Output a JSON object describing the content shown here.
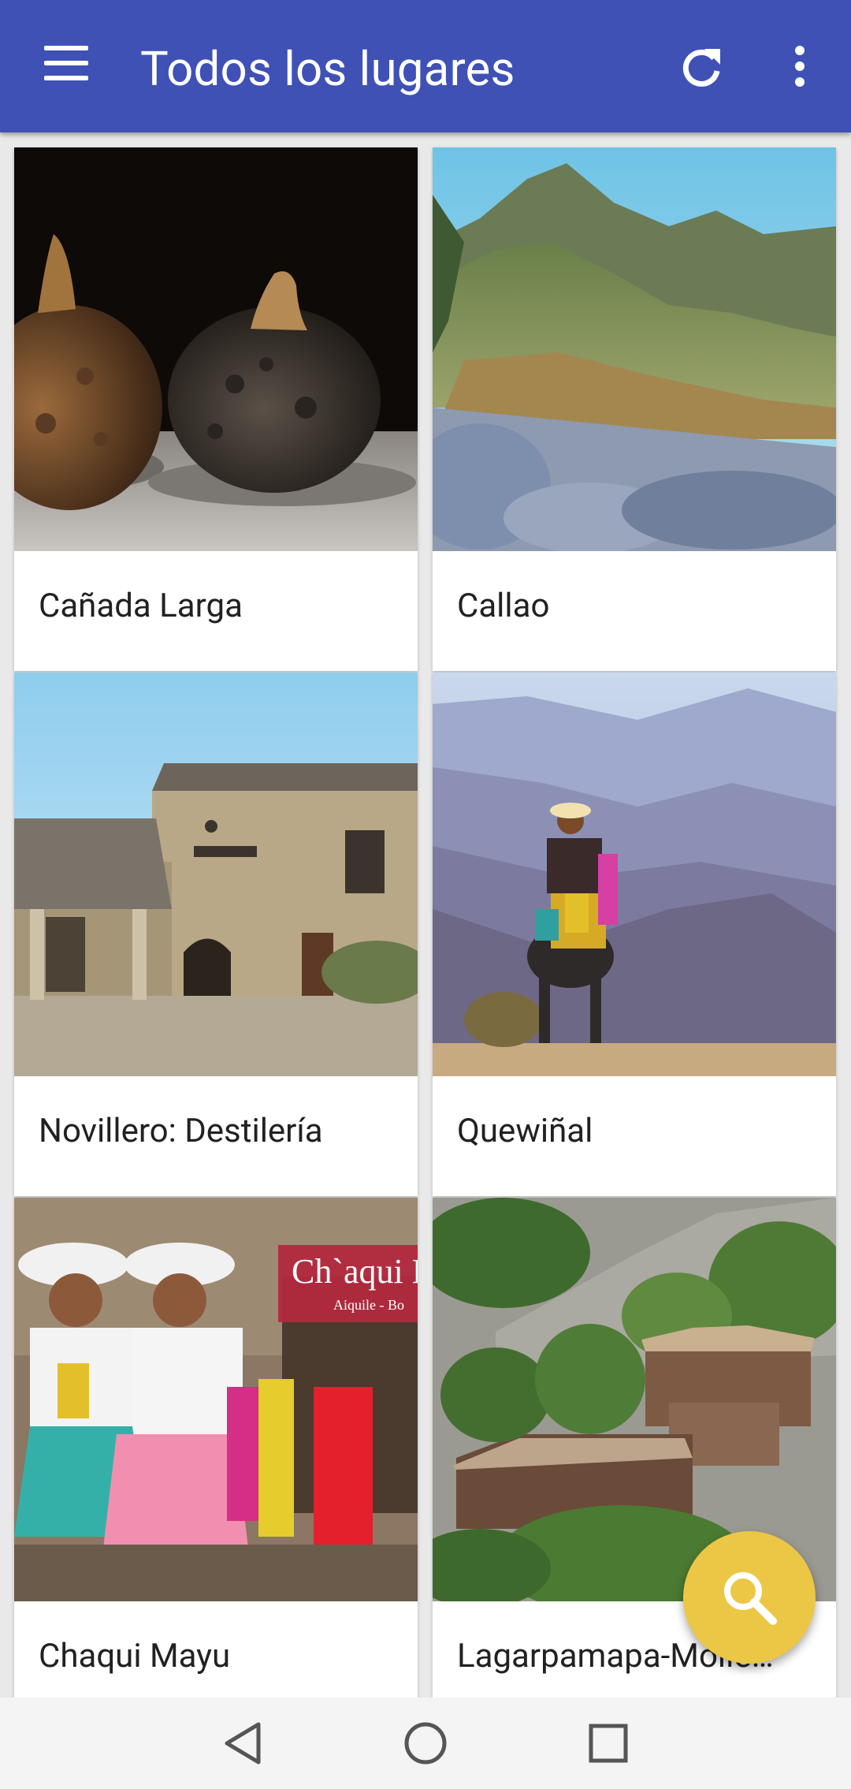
{
  "appbar": {
    "title": "Todos los lugares",
    "menu_icon": "hamburger-menu-icon",
    "refresh_icon": "refresh-icon",
    "more_icon": "more-vert-icon",
    "color": "#3f51b5"
  },
  "places": [
    {
      "name": "Cañada Larga"
    },
    {
      "name": "Callao"
    },
    {
      "name": "Novillero: Destilería"
    },
    {
      "name": "Quewiñal"
    },
    {
      "name": "Chaqui Mayu",
      "image_text": {
        "title": "Ch`aqui M",
        "subtitle": "Aiquile - Bo"
      }
    },
    {
      "name": "Lagarpamapa-Molle…"
    }
  ],
  "fab": {
    "icon": "search-icon",
    "color": "#ecc745"
  },
  "navbar": {
    "back_icon": "back-triangle-icon",
    "home_icon": "home-circle-icon",
    "recents_icon": "recents-square-icon"
  }
}
